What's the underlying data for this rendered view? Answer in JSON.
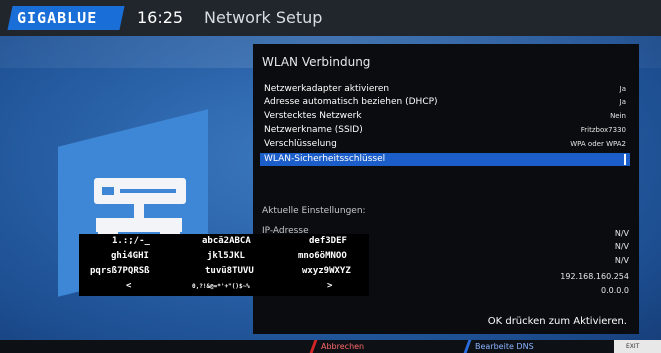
{
  "header": {
    "logo": "GIGABLUE",
    "clock": "16:25",
    "title": "Network Setup"
  },
  "panel": {
    "title": "WLAN Verbindung",
    "rows": [
      {
        "label": "Netzwerkadapter aktivieren",
        "value": "Ja"
      },
      {
        "label": "Adresse automatisch beziehen (DHCP)",
        "value": "Ja"
      },
      {
        "label": "Verstecktes Netzwerk",
        "value": "Nein"
      },
      {
        "label": "Netzwerkname (SSID)",
        "value": "Fritzbox7330"
      },
      {
        "label": "Verschlüsselung",
        "value": "WPA oder WPA2"
      },
      {
        "label": "WLAN-Sicherheitsschlüssel",
        "value": ""
      }
    ],
    "current_settings_label": "Aktuelle Einstellungen:",
    "ip_label": "IP-Adresse",
    "info_values": [
      "N/V",
      "N/V",
      "N/V",
      "192.168.160.254",
      "0.0.0.0"
    ],
    "ok_hint": "OK drücken zum Aktivieren."
  },
  "keypad": {
    "rows": [
      [
        "1.:;/-_",
        "abcä2ABCA",
        "def3DEF"
      ],
      [
        "ghi4GHI",
        "jkl5JKL",
        "mno6öMNOO"
      ],
      [
        "pqrsß7PQRSß",
        "tuvü8TUVU",
        "wxyz9WXYZ"
      ],
      [
        "<",
        "0,?!&@=*'+\"()$~%",
        ">"
      ]
    ]
  },
  "footer": {
    "red_label": "Abbrechen",
    "blue_label": "Bearbeite DNS",
    "exit_label": "EXIT",
    "colors": {
      "red": "#d32626",
      "blue": "#2b6de0"
    }
  },
  "colors": {
    "accent": "#1c5ec9",
    "background": "#2a62a8",
    "panel": "#0a0c0f"
  }
}
